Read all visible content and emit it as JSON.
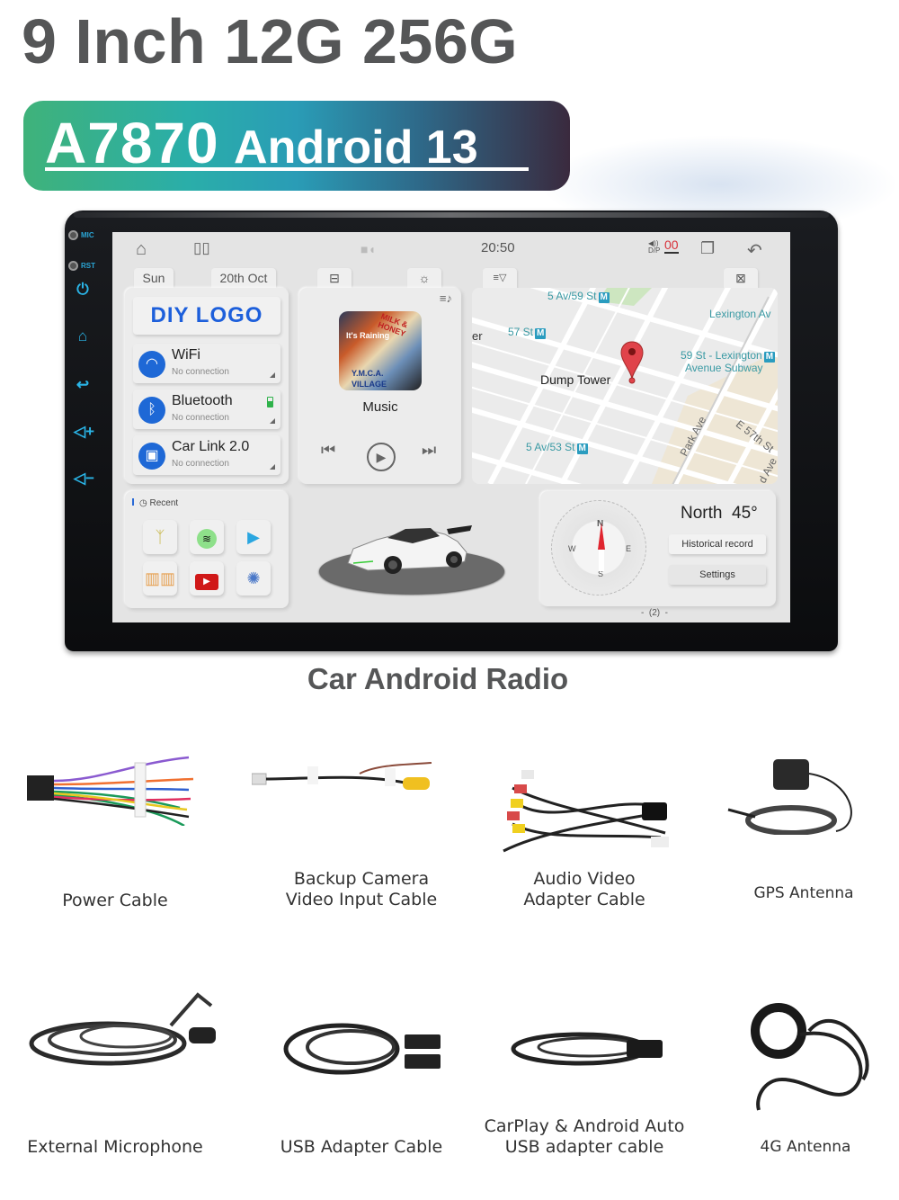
{
  "header": {
    "headline": "9 Inch 12G 256G",
    "model": "A7870",
    "os": "Android 13"
  },
  "device": {
    "hardware_labels": {
      "mic": "MIC",
      "rst": "RST"
    },
    "hardware_keys": [
      "power-icon",
      "home-icon",
      "back-icon",
      "volume-up-icon",
      "volume-down-icon"
    ],
    "status_bar": {
      "time": "20:50",
      "dsp_label": "D/P",
      "dsp_value": "00",
      "icons": [
        "home-icon",
        "split-screen-icon",
        "dashcam-icon",
        "dsp-volume-icon",
        "recent-apps-icon",
        "back-arrow-icon"
      ]
    },
    "tabs": [
      {
        "label": "Sun"
      },
      {
        "label": "20th Oct"
      },
      {
        "icon": "car-seat-icon"
      },
      {
        "icon": "bulb-icon"
      },
      {
        "icon": "filter-icon",
        "label": "≡▽"
      },
      {
        "icon": "fullscreen-icon"
      }
    ],
    "connectivity": {
      "logo": "DIY LOGO",
      "items": [
        {
          "name": "WiFi",
          "status": "No connection",
          "icon": "wifi-icon"
        },
        {
          "name": "Bluetooth",
          "status": "No connection",
          "icon": "bluetooth-icon",
          "battery": true
        },
        {
          "name": "Car Link 2.0",
          "status": "No connection",
          "icon": "carlink-icon"
        }
      ]
    },
    "music": {
      "title": "Music",
      "album_text": [
        "It's Raining",
        "MILK & HONEY",
        "Y.M.C.A.",
        "VILLAGE"
      ],
      "controls": [
        "previous",
        "play",
        "next"
      ]
    },
    "map": {
      "place": "Dump Tower",
      "labels": [
        "5 Av/59 St",
        "Lexington Av",
        "57 St",
        "59 St - Lexington",
        "Avenue Subway",
        "5 Av/53 St",
        "Park Ave",
        "E 57th St",
        "d Ave",
        "er"
      ],
      "transit_badge": "M"
    },
    "recent": {
      "label": "Recent",
      "apps": [
        "antenna-app",
        "spotify-app",
        "play-store-app",
        "book-app",
        "youtube-app",
        "settings-app"
      ]
    },
    "compass": {
      "direction": "North",
      "degrees": "45°",
      "cardinals": [
        "N",
        "E",
        "S",
        "W"
      ],
      "buttons": [
        "Historical record",
        "Settings"
      ]
    },
    "page_indicator": "2"
  },
  "product_name": "Car Android Radio",
  "accessories": [
    {
      "name": [
        "Power Cable"
      ]
    },
    {
      "name": [
        "Backup Camera",
        "Video Input Cable"
      ]
    },
    {
      "name": [
        "Audio Video",
        "Adapter Cable"
      ]
    },
    {
      "name": [
        "GPS Antenna"
      ]
    },
    {
      "name": [
        "External Microphone"
      ]
    },
    {
      "name": [
        "USB Adapter Cable"
      ]
    },
    {
      "name": [
        "CarPlay & Android Auto",
        "USB adapter cable"
      ]
    },
    {
      "name": [
        "4G Antenna"
      ]
    }
  ],
  "colors": {
    "headline": "#555657",
    "logo_blue": "#1d5fdb",
    "key_blue": "#2ab4e6",
    "dsp_red": "#d8323a",
    "pin_red": "#e0434a"
  }
}
